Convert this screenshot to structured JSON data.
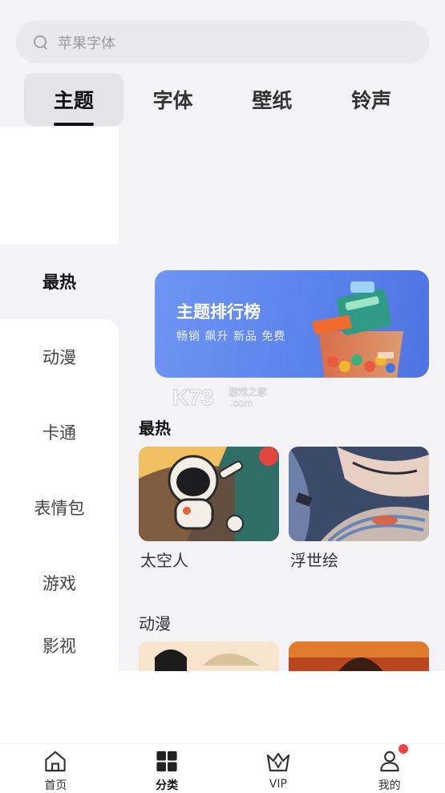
{
  "search": {
    "placeholder": "苹果字体"
  },
  "tabs": [
    {
      "label": "主题",
      "active": true
    },
    {
      "label": "字体",
      "active": false
    },
    {
      "label": "壁纸",
      "active": false
    },
    {
      "label": "铃声",
      "active": false
    }
  ],
  "sidebar": {
    "items": [
      {
        "label": "最热",
        "active": true
      },
      {
        "label": "动漫",
        "active": false
      },
      {
        "label": "卡通",
        "active": false
      },
      {
        "label": "表情包",
        "active": false
      },
      {
        "label": "游戏",
        "active": false
      },
      {
        "label": "影视",
        "active": false
      }
    ]
  },
  "banner": {
    "title": "主题排行榜",
    "subtitle": "畅销 飙升 新品 免费"
  },
  "watermark": {
    "brand": "K73",
    "site_name": "游戏之家",
    "domain": ".com"
  },
  "sections": [
    {
      "title": "最热",
      "cards": [
        {
          "label": "太空人",
          "icon": "astronaut-thumbnail"
        },
        {
          "label": "浮世绘",
          "icon": "ukiyoe-thumbnail"
        }
      ]
    },
    {
      "title": "动漫",
      "cards": [
        {
          "label": "",
          "icon": "anime-thumbnail"
        },
        {
          "label": "",
          "icon": "action-thumbnail"
        }
      ]
    }
  ],
  "bottom_nav": {
    "items": [
      {
        "label": "首页",
        "icon": "home-icon",
        "active": false
      },
      {
        "label": "分类",
        "icon": "grid-icon",
        "active": true
      },
      {
        "label": "VIP",
        "icon": "crown-icon",
        "active": false
      },
      {
        "label": "我的",
        "icon": "user-icon",
        "active": false,
        "badge": true
      }
    ]
  },
  "colors": {
    "accent": "#5b83ec",
    "badge": "#e64646",
    "background": "#f3f3f5"
  }
}
